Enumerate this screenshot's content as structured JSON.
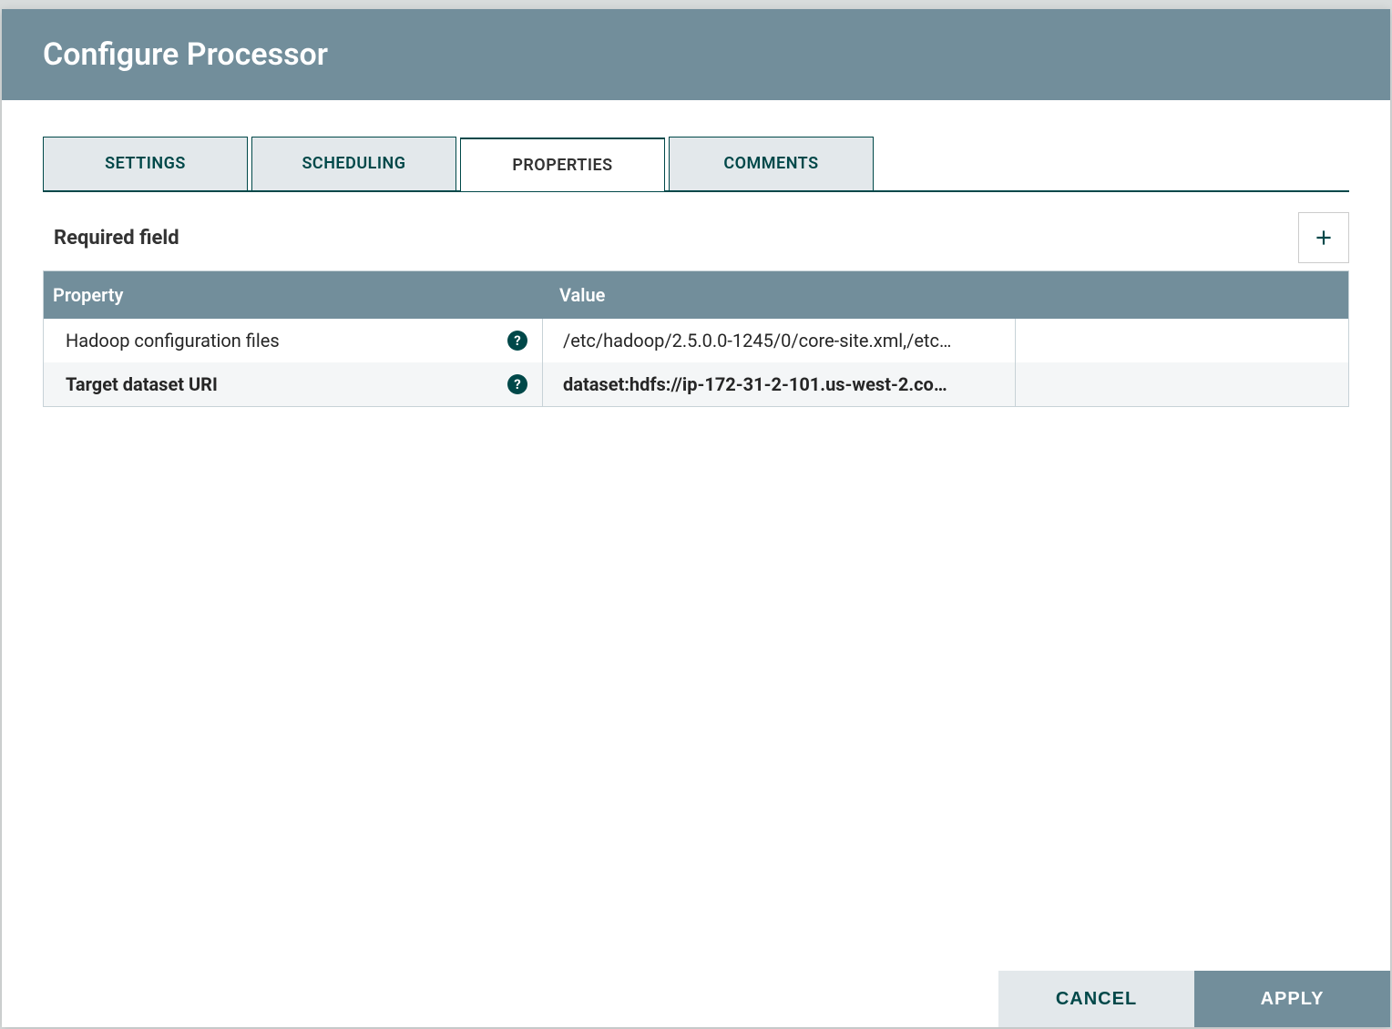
{
  "dialog": {
    "title": "Configure Processor"
  },
  "tabs": {
    "settings": "Settings",
    "scheduling": "Scheduling",
    "properties": "Properties",
    "comments": "Comments"
  },
  "properties_panel": {
    "required_label": "Required field",
    "header_property": "Property",
    "header_value": "Value"
  },
  "properties": [
    {
      "name": "Hadoop configuration files",
      "value": "/etc/hadoop/2.5.0.0-1245/0/core-site.xml,/etc…",
      "required": false
    },
    {
      "name": "Target dataset URI",
      "value": "dataset:hdfs://ip-172-31-2-101.us-west-2.co…",
      "required": true
    }
  ],
  "buttons": {
    "cancel": "Cancel",
    "apply": "Apply"
  }
}
